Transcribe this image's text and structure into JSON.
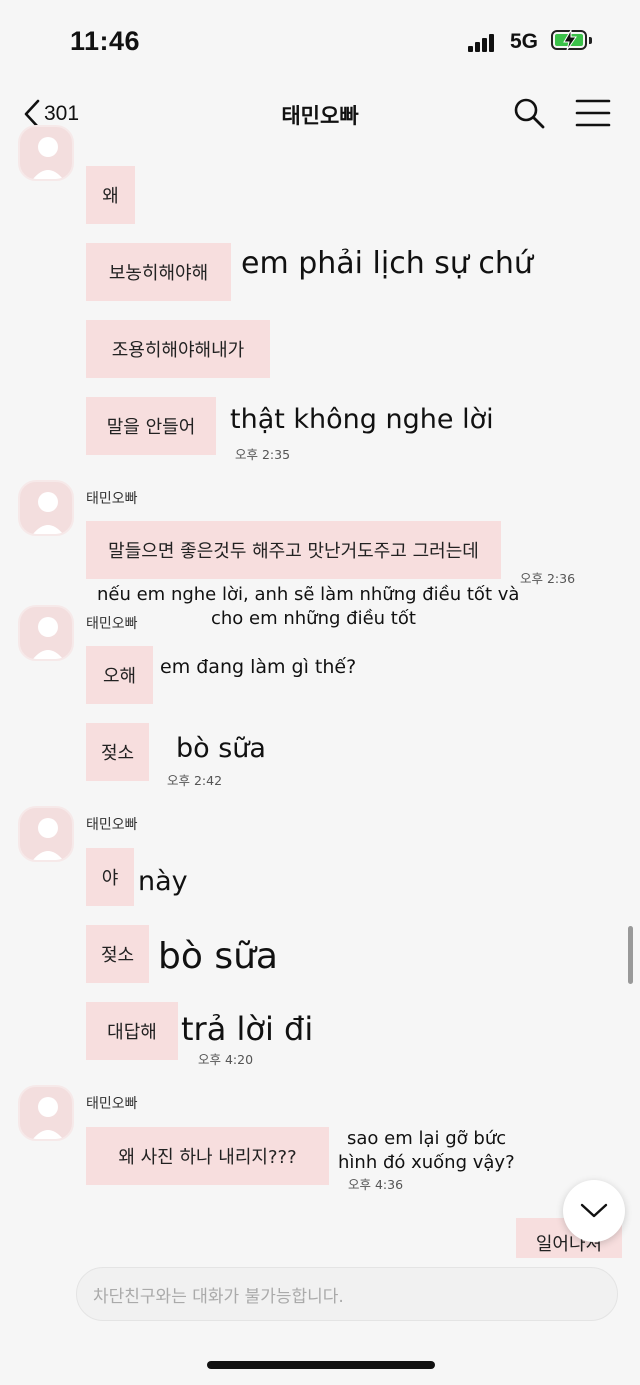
{
  "status_bar": {
    "time": "11:46",
    "network": "5G"
  },
  "header": {
    "back_count": "301",
    "title": "태민오빠"
  },
  "messages": {
    "m1": "왜",
    "m2": "보농히해야해",
    "m2_note": "em phải lịch sự chứ",
    "m3": "조용히해야해내가",
    "m4": "말을 안들어",
    "m4_note": "thật không nghe lời",
    "m4_time": "오후 2:35",
    "g2_sender": "태민오빠",
    "m5": "말들으면 좋은것두 해주고 맛난거도주고 그러는데",
    "m5_time": "오후 2:36",
    "m5_note_1": "nếu em nghe lời, anh sẽ làm những điều tốt và",
    "m5_note_2": "cho em những điều tốt",
    "g3_sender": "태민오빠",
    "m6": "오해",
    "m6_note": "em đang làm gì thế?",
    "m7": "젖소",
    "m7_note": "bò sữa",
    "m7_time": "오후 2:42",
    "g4_sender": "태민오빠",
    "m8": "야",
    "m8_note": "này",
    "m9": "젖소",
    "m9_note": "bò sữa",
    "m10": "대답해",
    "m10_note": "trả lời đi",
    "m10_time": "오후 4:20",
    "g5_sender": "태민오빠",
    "m11": "왜 사진 하나 내리지???",
    "m11_note_1": "sao em lại gỡ bức",
    "m11_note_2": "hình đó xuống vậy?",
    "m11_time": "오후 4:36",
    "m12": "일어나셔"
  },
  "input": {
    "placeholder": "차단친구와는 대화가 불가능합니다."
  },
  "colors": {
    "bubble": "#f7dede",
    "background": "#f6f6f6",
    "battery": "#3bc14a"
  }
}
